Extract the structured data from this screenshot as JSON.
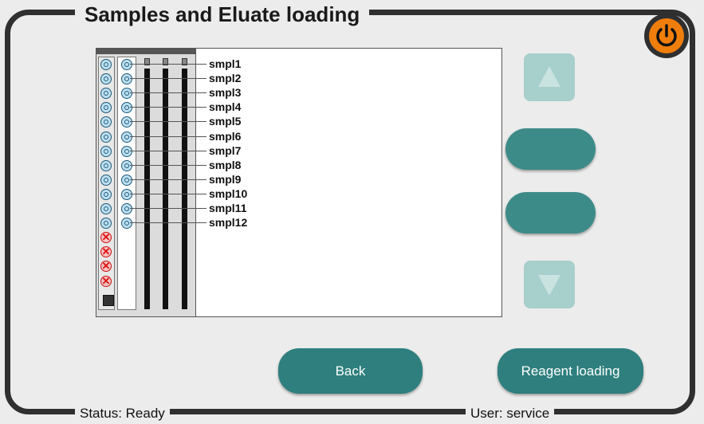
{
  "window": {
    "title": "Samples and Eluate loading"
  },
  "icons": {
    "power": "power-icon",
    "up": "arrow-up-icon",
    "down": "arrow-down-icon"
  },
  "colors": {
    "accent": "#2e7f7e",
    "power": "#f07e0c",
    "disabled": "#a7cfcc",
    "frame": "#2f2f2f"
  },
  "samples": [
    {
      "label": "smpl1"
    },
    {
      "label": "smpl2"
    },
    {
      "label": "smpl3"
    },
    {
      "label": "smpl4"
    },
    {
      "label": "smpl5"
    },
    {
      "label": "smpl6"
    },
    {
      "label": "smpl7"
    },
    {
      "label": "smpl8"
    },
    {
      "label": "smpl9"
    },
    {
      "label": "smpl10"
    },
    {
      "label": "smpl11"
    },
    {
      "label": "smpl12"
    }
  ],
  "rack": {
    "loaded_positions": 12,
    "empty_positions": 4
  },
  "buttons": {
    "back": "Back",
    "reagent_loading": "Reagent loading",
    "side_1": "",
    "side_2": ""
  },
  "status": {
    "text": "Status: Ready",
    "user": "User: service"
  }
}
